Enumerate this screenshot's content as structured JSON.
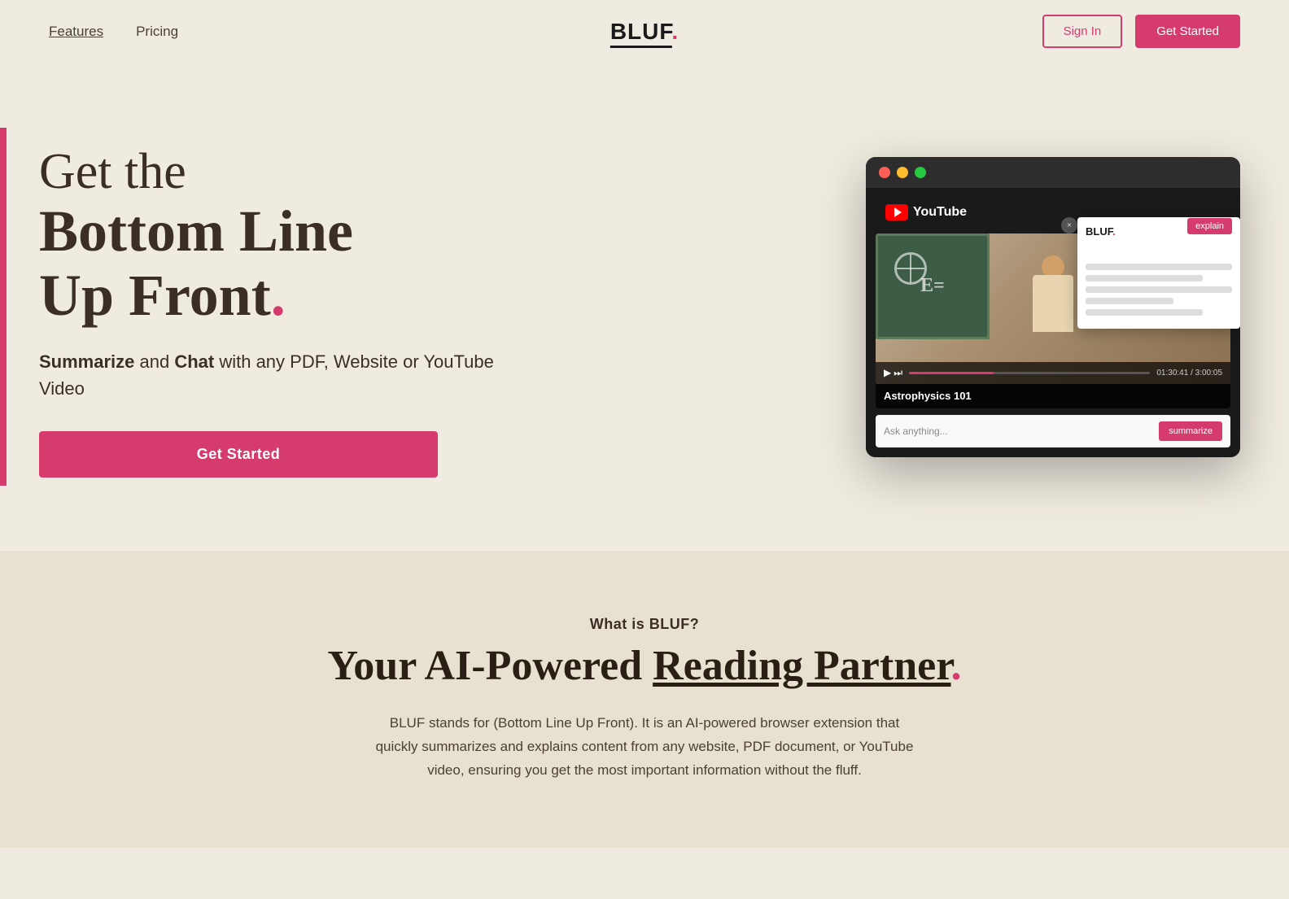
{
  "nav": {
    "links": [
      {
        "label": "Features",
        "active": false
      },
      {
        "label": "Pricing",
        "active": false
      }
    ],
    "logo": "BLUF",
    "logo_dot": ".",
    "signin_label": "Sign In",
    "getstarted_label": "Get Started"
  },
  "hero": {
    "title_line1": "Get the",
    "title_line2": "Bottom Line",
    "title_line3": "Up Front",
    "title_dot": ".",
    "subtitle_part1": "Summarize",
    "subtitle_and": " and ",
    "subtitle_part2": "Chat",
    "subtitle_rest": " with any PDF, Website or YouTube Video",
    "cta_label": "Get Started"
  },
  "browser": {
    "youtube_label": "YouTube",
    "video_title": "Astrophysics 101",
    "time": "01:30:41 / 3:00:05",
    "bluf_panel_title": "BLUF",
    "bluf_panel_dot": ".",
    "explain_label": "explain",
    "close_label": "×",
    "chat_placeholder": "Ask anything...",
    "summarize_label": "summarize"
  },
  "what": {
    "subtitle": "What is BLUF?",
    "title_part1": "Your AI-Powered ",
    "title_underlined": "Reading Partner",
    "title_dot": ".",
    "description": "BLUF stands for (Bottom Line Up Front). It is an AI-powered browser extension that quickly summarizes and explains content from any website, PDF document, or YouTube video, ensuring you get the most important information without the fluff."
  },
  "colors": {
    "accent": "#d63b6e",
    "bg_hero": "#f0ebe0",
    "bg_what": "#e8e0d0",
    "text_dark": "#3a2e25"
  }
}
